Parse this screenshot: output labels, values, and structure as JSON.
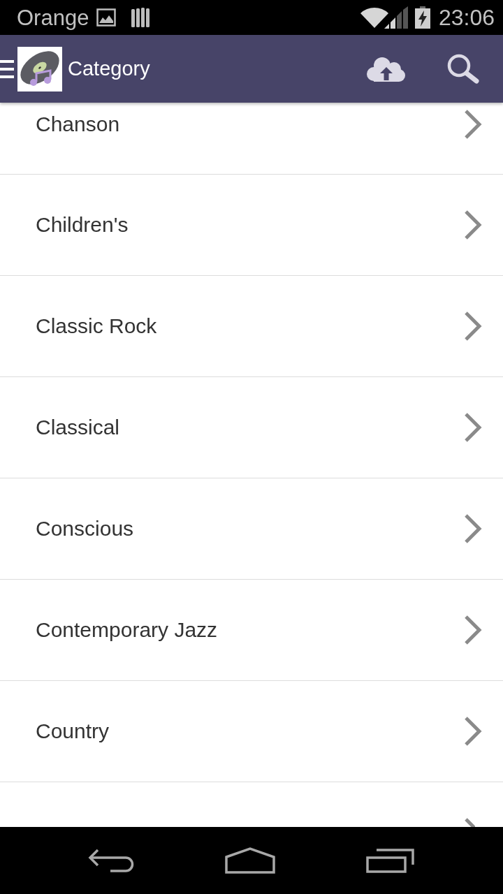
{
  "status_bar": {
    "carrier": "Orange",
    "time": "23:06"
  },
  "app_bar": {
    "title": "Category"
  },
  "categories": [
    {
      "kind": "cut_top",
      "label": "Chanson"
    },
    {
      "kind": "full",
      "label": "Children's"
    },
    {
      "kind": "full",
      "label": "Classic Rock"
    },
    {
      "kind": "full",
      "label": "Classical"
    },
    {
      "kind": "full",
      "label": "Conscious"
    },
    {
      "kind": "full",
      "label": "Contemporary Jazz"
    },
    {
      "kind": "full",
      "label": "Country"
    },
    {
      "kind": "cut_bottom"
    }
  ]
}
